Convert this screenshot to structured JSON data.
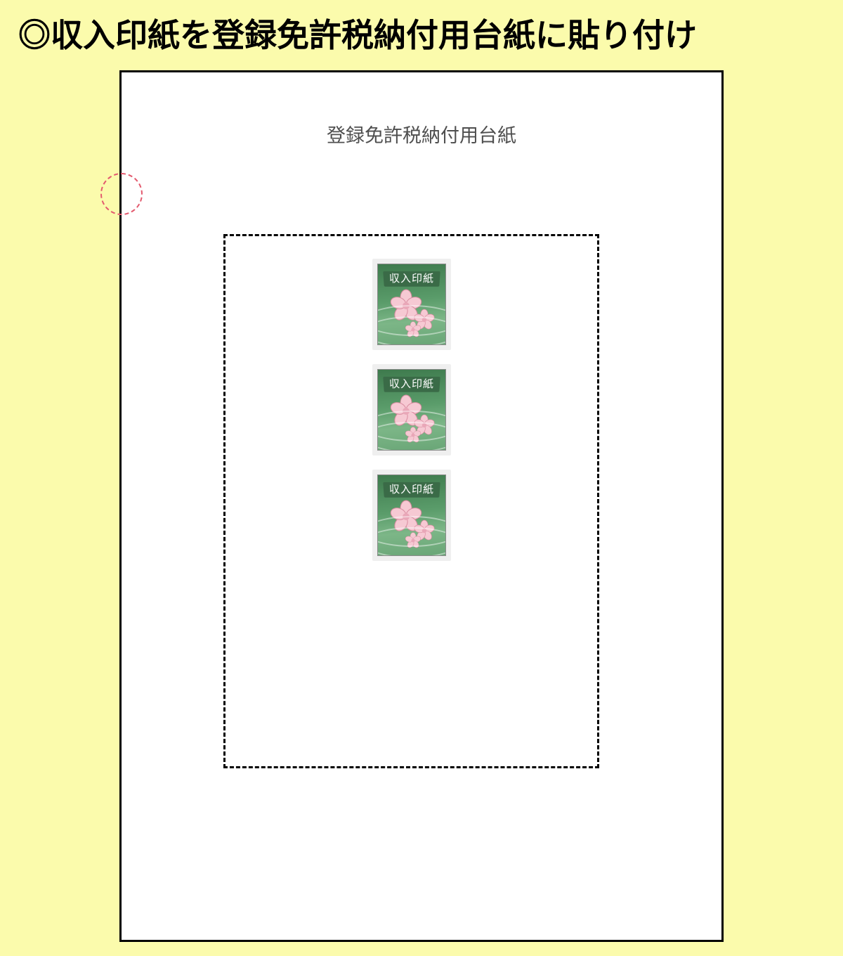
{
  "title": "◎収入印紙を登録免許税納付用台紙に貼り付け",
  "paper": {
    "header": "登録免許税納付用台紙"
  },
  "stamps": [
    {
      "label": "収入印紙"
    },
    {
      "label": "収入印紙"
    },
    {
      "label": "収入印紙"
    }
  ],
  "colors": {
    "background": "#fbfbac",
    "stamp_primary": "#5a9c6a",
    "notch": "#e35b6f"
  }
}
